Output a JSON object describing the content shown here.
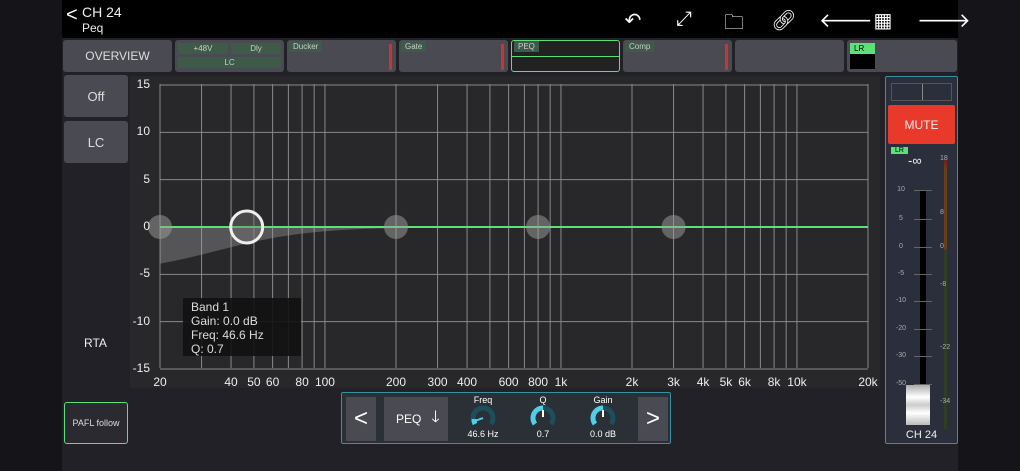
{
  "header": {
    "channel": "CH 24",
    "page": "Peq"
  },
  "toolbar": {
    "icons": [
      "undo-icon",
      "fullscreen-icon",
      "folder-icon",
      "link-icon",
      "arrow-left-icon",
      "grid-icon",
      "arrow-right-icon"
    ]
  },
  "strip": {
    "overview": "OVERVIEW",
    "phantom": "+48V",
    "delay": "Dly",
    "lowcut": "LC",
    "ducker": "Ducker",
    "gate": "Gate",
    "peq": "PEQ",
    "comp": "Comp",
    "bus": "LR"
  },
  "side": {
    "off": "Off",
    "lc": "LC",
    "rta": "RTA",
    "pafl": "PAFL follow"
  },
  "graph": {
    "y_ticks": [
      "15",
      "10",
      "5",
      "0",
      "-5",
      "-10",
      "-15"
    ],
    "x_labels": [
      [
        "20",
        20
      ],
      [
        "40",
        40
      ],
      [
        "50",
        50
      ],
      [
        "60",
        60
      ],
      [
        "80",
        80
      ],
      [
        "100",
        100
      ],
      [
        "200",
        200
      ],
      [
        "300",
        300
      ],
      [
        "400",
        400
      ],
      [
        "600",
        600
      ],
      [
        "800",
        800
      ],
      [
        "1k",
        1000
      ],
      [
        "2k",
        2000
      ],
      [
        "3k",
        3000
      ],
      [
        "4k",
        4000
      ],
      [
        "5k",
        5000
      ],
      [
        "6k",
        6000
      ],
      [
        "8k",
        8000
      ],
      [
        "10k",
        10000
      ],
      [
        "20k",
        20000
      ]
    ],
    "bands_hz": [
      20,
      46.6,
      200,
      800,
      3000
    ],
    "selected_band": 1
  },
  "info": {
    "band": "Band 1",
    "gain": "Gain: 0.0 dB",
    "freq": "Freq: 46.6 Hz",
    "q": "Q: 0.7"
  },
  "peq": {
    "mode": "PEQ",
    "freq_label": "Freq",
    "freq": "46.6 Hz",
    "q_label": "Q",
    "q": "0.7",
    "gain_label": "Gain",
    "gain": "0.0 dB"
  },
  "fader": {
    "mute": "MUTE",
    "bus": "LR",
    "level": "-∞",
    "scale": [
      "10",
      "5",
      "0",
      "-5",
      "-10",
      "-20",
      "-30",
      "-50"
    ],
    "meter": [
      "18",
      "8",
      "0",
      "-8",
      "-22",
      "-34"
    ],
    "name": "CH 24"
  },
  "colors": {
    "accent": "#5de07a",
    "mute": "#e8392a",
    "knob": "#4fd0e8"
  }
}
